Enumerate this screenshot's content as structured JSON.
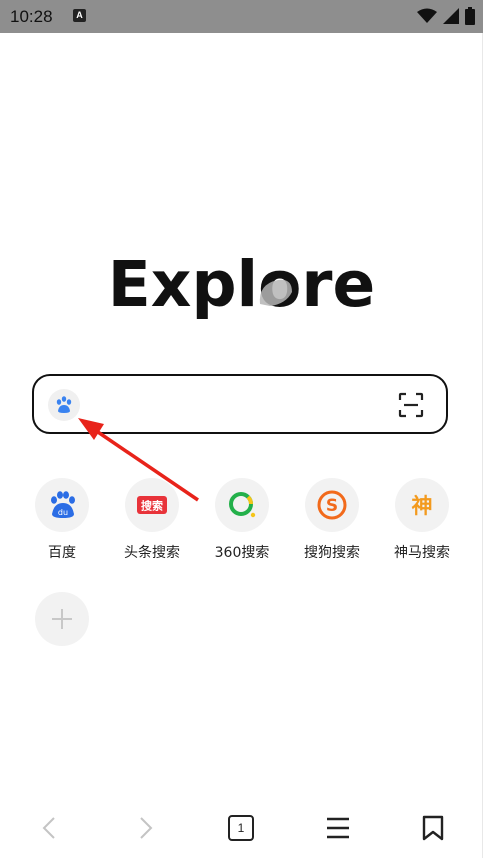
{
  "status_bar": {
    "time": "10:28",
    "notification_badge": "A"
  },
  "logo": {
    "text": "Explore"
  },
  "search": {
    "engine_icon": "baidu-paw-icon",
    "scan_icon": "scan-icon"
  },
  "shortcuts": [
    {
      "label": "百度",
      "icon": "baidu-icon",
      "badge": "du",
      "color": "#2b6de5"
    },
    {
      "label": "头条搜索",
      "icon": "toutiao-search-icon",
      "badge": "搜索",
      "color": "#e8333a"
    },
    {
      "label": "360搜索",
      "icon": "360-search-icon",
      "color": "#23b04a"
    },
    {
      "label": "搜狗搜索",
      "icon": "sogou-icon",
      "badge": "S",
      "color": "#f26a1b"
    },
    {
      "label": "神马搜索",
      "icon": "shenma-icon",
      "badge": "神",
      "color": "#f39a1e"
    }
  ],
  "add_shortcut": {
    "icon": "plus-icon"
  },
  "bottom_nav": {
    "back_icon": "chevron-left-icon",
    "forward_icon": "chevron-right-icon",
    "tabs_count": "1",
    "menu_icon": "menu-icon",
    "bookmark_icon": "bookmark-icon"
  },
  "colors": {
    "status_bar_bg": "#8e8e8e",
    "annotation_arrow": "#e8231a",
    "baidu_blue": "#3a83f0"
  }
}
